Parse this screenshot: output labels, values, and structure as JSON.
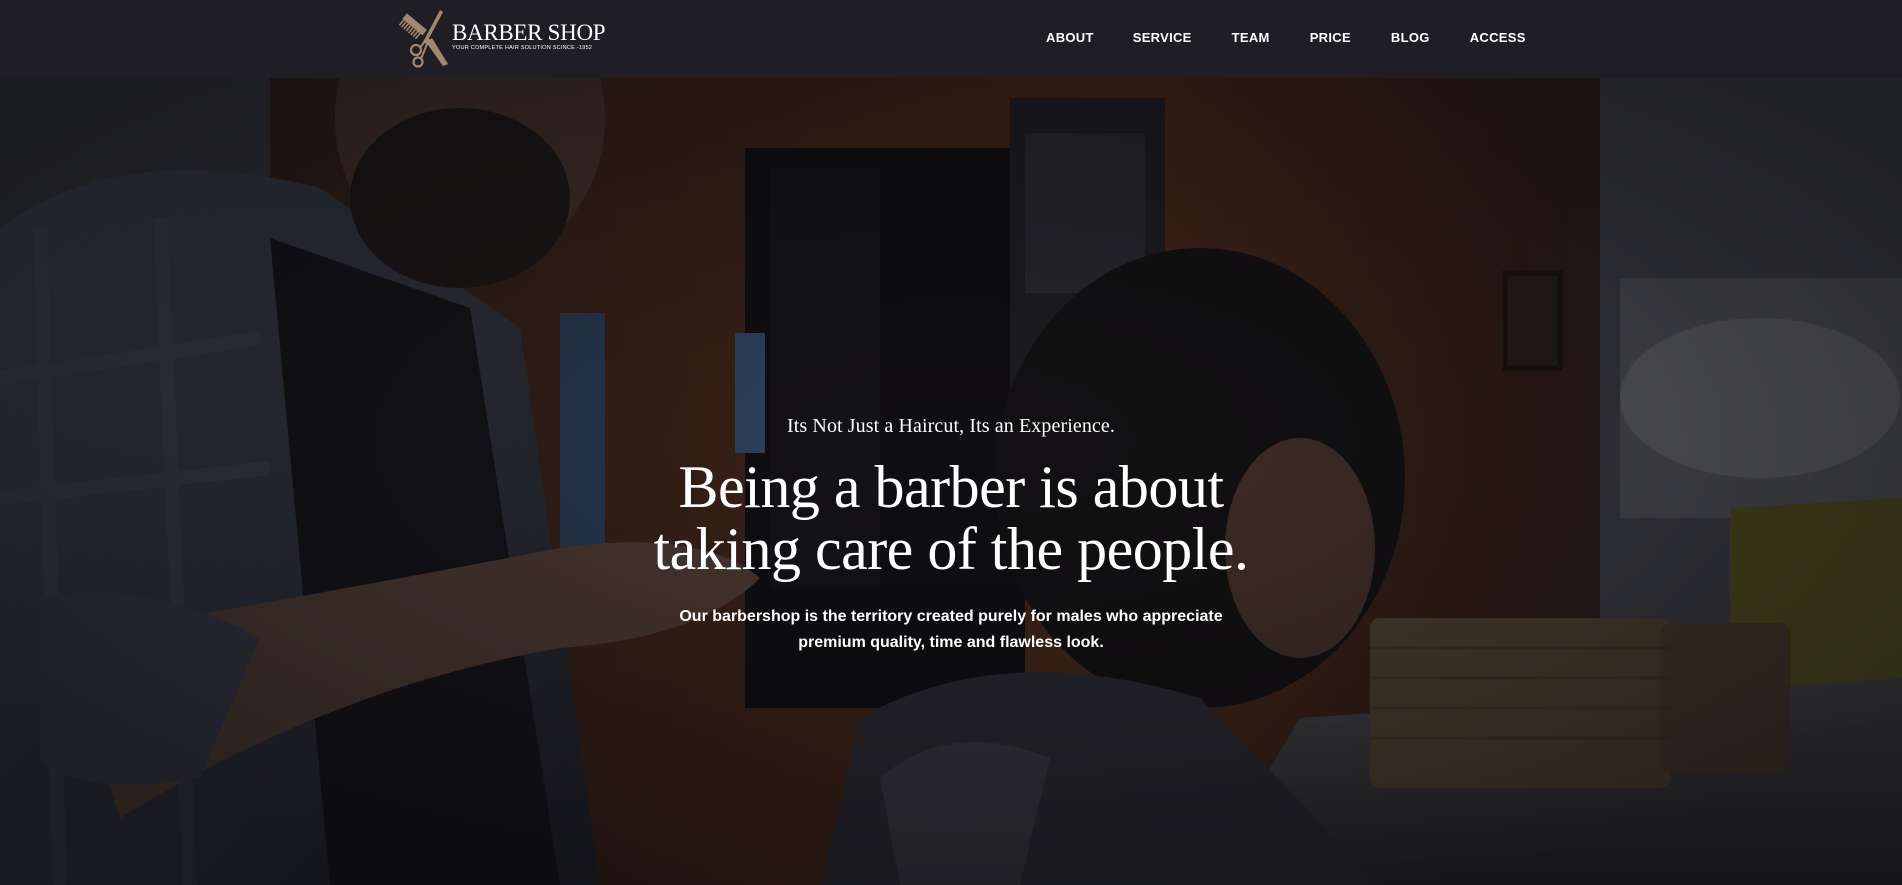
{
  "brand": {
    "name": "BARBER SHOP",
    "tagline": "YOUR COMPLETE HAIR SOLUTION SCINCE -1952",
    "logo_icon": "comb-and-scissors-icon",
    "accent_color": "#a08770"
  },
  "nav": {
    "items": [
      {
        "label": "ABOUT"
      },
      {
        "label": "SERVICE"
      },
      {
        "label": "TEAM"
      },
      {
        "label": "PRICE"
      },
      {
        "label": "BLOG"
      },
      {
        "label": "ACCESS"
      }
    ]
  },
  "hero": {
    "eyebrow": "Its Not Just a Haircut, Its an Experience.",
    "headline_line1": "Being a barber is about",
    "headline_line2": "taking care of the people.",
    "subtext_line1": "Our barbershop is the territory created purely for males who appreciate",
    "subtext_line2": "premium quality, time and flawless look.",
    "background": "barbershop-video-still"
  },
  "colors": {
    "header_bg": "#1f1e24",
    "text": "#ffffff"
  }
}
